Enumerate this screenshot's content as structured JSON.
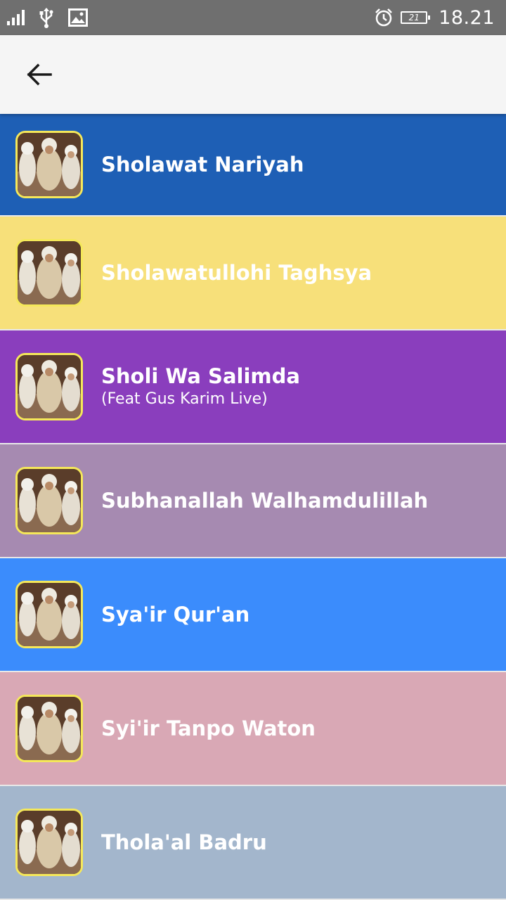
{
  "status_bar": {
    "time": "18.21",
    "battery_level": "21"
  },
  "app_bar": {
    "back_icon": "arrow-left-icon"
  },
  "songs": [
    {
      "title": "Sholawat Nariyah",
      "subtitle": "",
      "color": "#1e5fb5"
    },
    {
      "title": "Sholawatullohi Taghsya",
      "subtitle": "",
      "color": "#f7e07a"
    },
    {
      "title": "Sholi Wa Salimda",
      "subtitle": "(Feat Gus Karim Live)",
      "color": "#8a3ebd"
    },
    {
      "title": "Subhanallah Walhamdulillah",
      "subtitle": "",
      "color": "#a68ab1"
    },
    {
      "title": "Sya'ir Qur'an",
      "subtitle": "",
      "color": "#3b8cfc"
    },
    {
      "title": "Syi'ir Tanpo Waton",
      "subtitle": "",
      "color": "#d9a8b5"
    },
    {
      "title": "Thola'al Badru",
      "subtitle": "",
      "color": "#a3b6cc"
    }
  ]
}
